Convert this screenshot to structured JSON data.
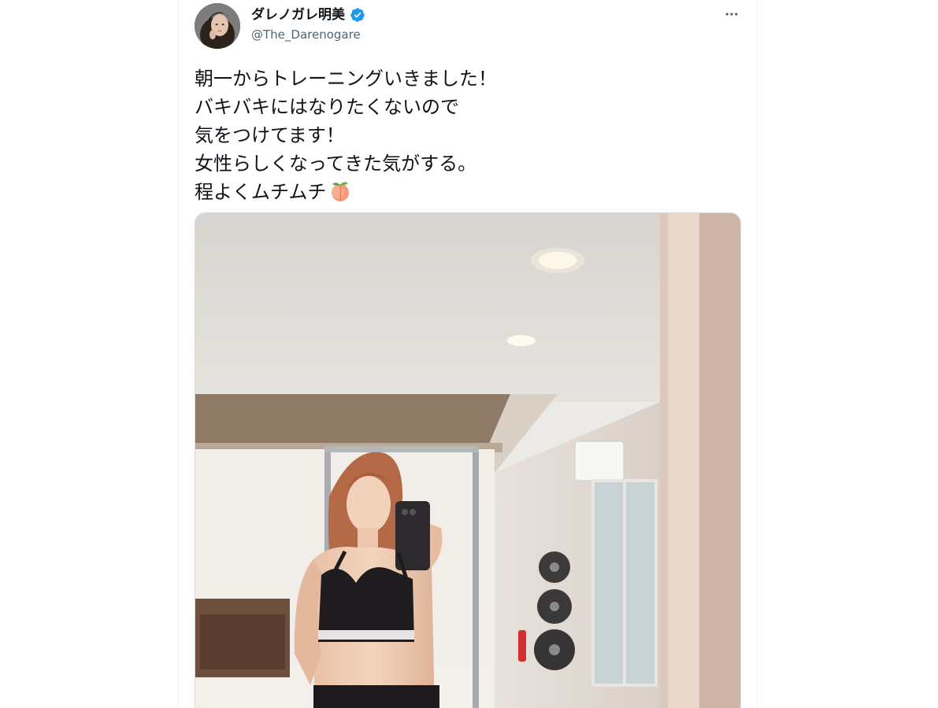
{
  "tweet": {
    "display_name": "ダレノガレ明美",
    "handle": "@The_Darenogare",
    "verified": true,
    "text_lines": [
      "朝一からトレーニングいきました！",
      "バキバキにはなりたくないので",
      "気をつけてます！",
      "女性らしくなってきた気がする。",
      "程よくムチムチ"
    ],
    "trailing_emoji": "peach-emoji",
    "more_icon": "more-horizontal-icon",
    "media_description_icon": "photo"
  },
  "colors": {
    "text_primary": "#0f1419",
    "text_secondary": "#536471",
    "verified_blue": "#1d9bf0",
    "border": "#cfd9de"
  }
}
